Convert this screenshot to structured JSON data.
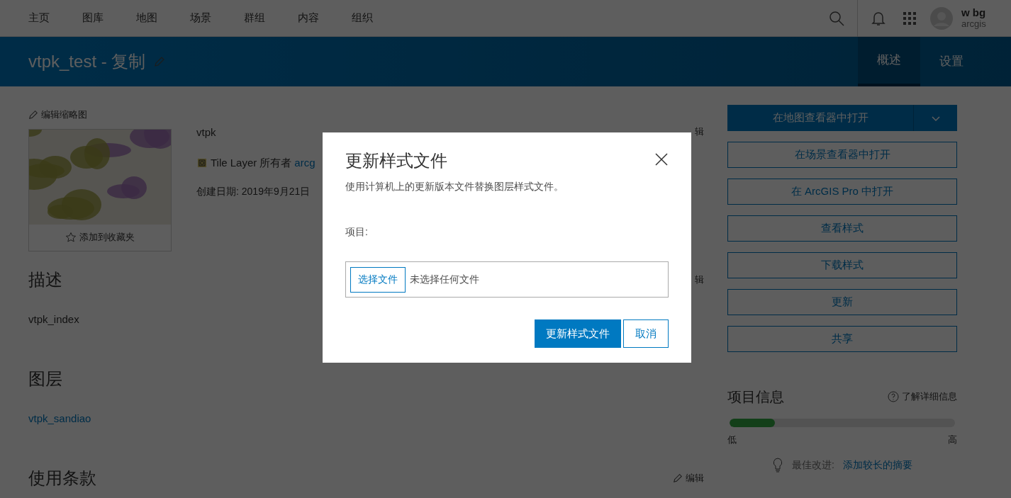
{
  "nav": {
    "items": [
      {
        "label": "主页"
      },
      {
        "label": "图库"
      },
      {
        "label": "地图"
      },
      {
        "label": "场景"
      },
      {
        "label": "群组"
      },
      {
        "label": "内容"
      },
      {
        "label": "组织"
      }
    ],
    "user": {
      "name": "w bg",
      "org": "arcgis"
    }
  },
  "header": {
    "title": "vtpk_test - 复制",
    "tabs": [
      {
        "label": "概述",
        "selected": true
      },
      {
        "label": "设置",
        "selected": false
      }
    ]
  },
  "item": {
    "edit_thumbnail": "编辑缩略图",
    "favorite": "添加到收藏夹",
    "summary": "vtpk",
    "edit": "辑",
    "type": "Tile Layer",
    "owner_label": "所有者",
    "owner": "arcg",
    "created": "创建日期: 2019年9月21日"
  },
  "sections": [
    {
      "title": "描述",
      "body": "vtpk_index",
      "kind": "text",
      "edit": "辑"
    },
    {
      "title": "图层",
      "body": "vtpk_sandiao",
      "kind": "link"
    },
    {
      "title": "使用条款",
      "edit": "编辑",
      "edit_icon": true
    }
  ],
  "actions": {
    "primary": "在地图查看器中打开",
    "buttons": [
      "在场景查看器中打开",
      "在 ArcGIS Pro 中打开",
      "查看样式",
      "下载样式",
      "更新",
      "共享"
    ]
  },
  "item_info": {
    "title": "项目信息",
    "help": "了解详细信息",
    "level": 0.2,
    "low": "低",
    "high": "高",
    "tip_label": "最佳改进:",
    "tip_link": "添加较长的摘要"
  },
  "dialog": {
    "title": "更新样式文件",
    "subtitle": "使用计算机上的更新版本文件替换图层样式文件。",
    "field_label": "项目:",
    "file_button": "选择文件",
    "file_status": "未选择任何文件",
    "buttons": [
      {
        "label": "更新样式文件",
        "kind": "primary"
      },
      {
        "label": "取消",
        "kind": "secondary"
      }
    ]
  }
}
